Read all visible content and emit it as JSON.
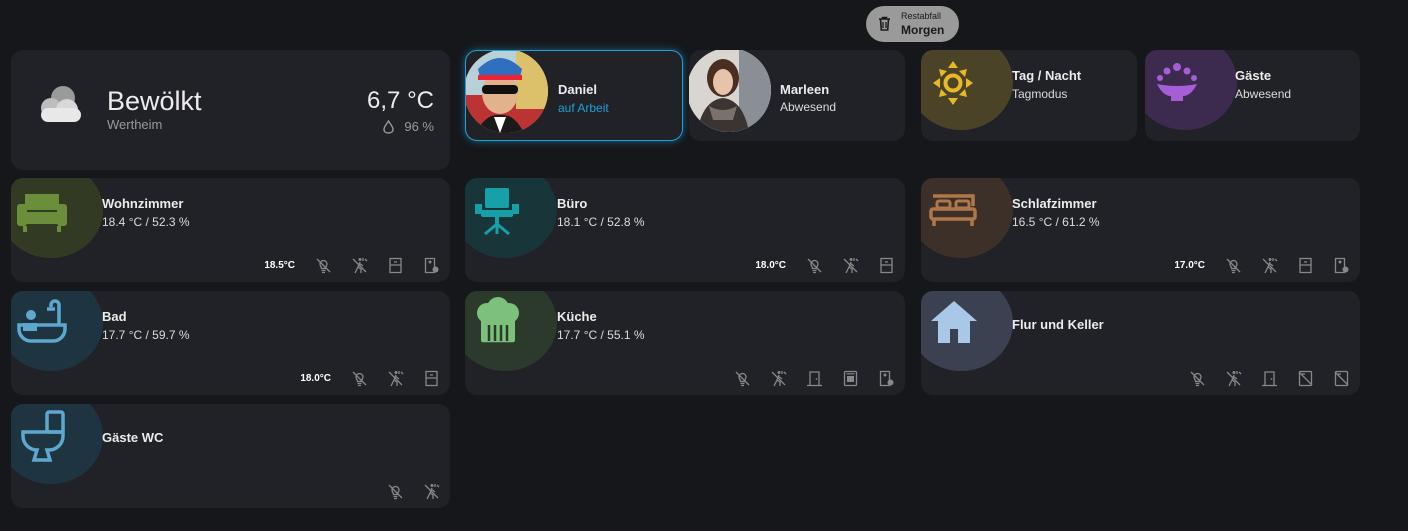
{
  "waste": {
    "label": "Restabfall",
    "when": "Morgen"
  },
  "weather": {
    "condition": "Bewölkt",
    "location": "Wertheim",
    "temperature": "6,7 °C",
    "humidity": "96 %"
  },
  "persons": [
    {
      "name": "Daniel",
      "status": "auf Arbeit"
    },
    {
      "name": "Marleen",
      "status": "Abwesend"
    }
  ],
  "modes": [
    {
      "name": "Tag / Nacht",
      "status": "Tagmodus",
      "icon": "sun-icon"
    },
    {
      "name": "Gäste",
      "status": "Abwesend",
      "icon": "guests-icon"
    }
  ],
  "rooms": [
    {
      "name": "Wohnzimmer",
      "climate": "18.4 °C / 52.3 %",
      "setpoint": "18.5°C",
      "icon": "sofa-icon"
    },
    {
      "name": "Büro",
      "climate": "18.1 °C / 52.8 %",
      "setpoint": "18.0°C",
      "icon": "office-chair-icon"
    },
    {
      "name": "Schlafzimmer",
      "climate": "16.5 °C / 61.2 %",
      "setpoint": "17.0°C",
      "icon": "bed-icon"
    },
    {
      "name": "Bad",
      "climate": "17.7 °C / 59.7 %",
      "setpoint": "18.0°C",
      "icon": "bathtub-icon"
    },
    {
      "name": "Küche",
      "climate": "17.7 °C / 55.1 %",
      "icon": "chef-hat-icon"
    },
    {
      "name": "Flur und Keller",
      "icon": "home-icon"
    },
    {
      "name": "Gäste WC",
      "icon": "toilet-icon"
    }
  ],
  "colors": {
    "background": "#16171b",
    "card": "#212228",
    "accent": "#1fa0d8"
  }
}
